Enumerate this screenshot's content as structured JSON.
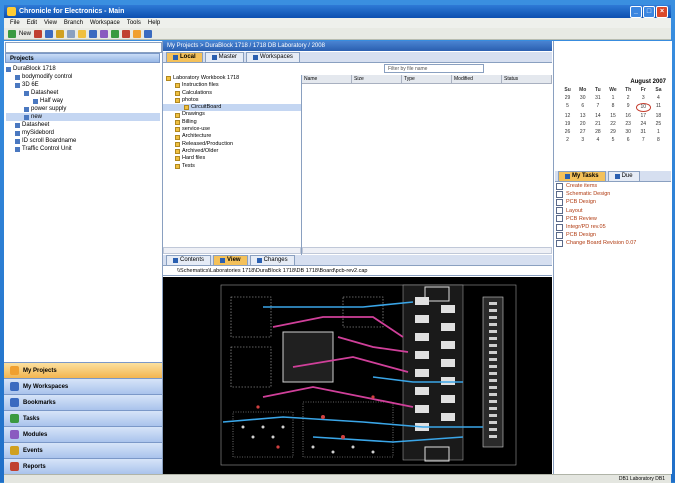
{
  "window": {
    "title": "Chronicle for Electronics - Main"
  },
  "menu": [
    "File",
    "Edit",
    "View",
    "Branch",
    "Workspace",
    "Tools",
    "Help"
  ],
  "toolbar": {
    "new_label": "New"
  },
  "left": {
    "header": "Projects",
    "tree": [
      {
        "label": "DuraBlock 1718",
        "indent": 0
      },
      {
        "label": "bodymodify control",
        "indent": 1
      },
      {
        "label": "3D 6E",
        "indent": 1
      },
      {
        "label": "Datasheet",
        "indent": 2
      },
      {
        "label": "Half way",
        "indent": 3
      },
      {
        "label": "power supply",
        "indent": 2
      },
      {
        "label": "new",
        "indent": 2,
        "selected": true
      },
      {
        "label": "Datasheet",
        "indent": 1
      },
      {
        "label": "mySidebord",
        "indent": 1
      },
      {
        "label": "ID scroll Boardname",
        "indent": 1
      },
      {
        "label": "Traffic Control Unit",
        "indent": 1
      }
    ],
    "nav": [
      {
        "label": "My Projects",
        "color": "#f0a030",
        "active": true
      },
      {
        "label": "My Workspaces",
        "color": "#3a6ac0"
      },
      {
        "label": "Bookmarks",
        "color": "#3a6ac0"
      },
      {
        "label": "Tasks",
        "color": "#3a9a40"
      },
      {
        "label": "Modules",
        "color": "#8a5ac0"
      },
      {
        "label": "Events",
        "color": "#d0a020"
      },
      {
        "label": "Reports",
        "color": "#c04030"
      }
    ]
  },
  "center": {
    "header": "My Projects > DuraBlock 1718 / 1718 DB Laboratory / 2008",
    "tabs": [
      "Local",
      "Master",
      "Workspaces"
    ],
    "filter_label": "Filter by file name",
    "list_columns": [
      "Name",
      "Size",
      "Type",
      "Modified",
      "Status"
    ],
    "file_tree": [
      {
        "label": "Laboratory Workbook 1718",
        "indent": 0
      },
      {
        "label": "Instruction files",
        "indent": 1
      },
      {
        "label": "Calculations",
        "indent": 1
      },
      {
        "label": "photos",
        "indent": 1
      },
      {
        "label": "CircuitBoard",
        "indent": 2,
        "selected": true
      },
      {
        "label": "Drawings",
        "indent": 1
      },
      {
        "label": "Billing",
        "indent": 1
      },
      {
        "label": "service-use",
        "indent": 1
      },
      {
        "label": "Architecture",
        "indent": 1
      },
      {
        "label": "Released/Production",
        "indent": 1
      },
      {
        "label": "Archived/Older",
        "indent": 1
      },
      {
        "label": "Hard files",
        "indent": 1
      },
      {
        "label": "Tests",
        "indent": 1
      }
    ],
    "view_tabs": [
      "Contents",
      "View",
      "Changes"
    ],
    "view_path": "\\\\Schematics\\Laboratories 1718\\DuraBlock 1718\\DB 1718\\Board\\pcb-rev2.cap"
  },
  "right": {
    "calendar": {
      "month": "August 2007",
      "days_header": [
        "Su",
        "Mo",
        "Tu",
        "We",
        "Th",
        "Fr",
        "Sa"
      ],
      "weeks": [
        [
          "29",
          "30",
          "31",
          "1",
          "2",
          "3",
          "4"
        ],
        [
          "5",
          "6",
          "7",
          "8",
          "9",
          "10",
          "11"
        ],
        [
          "12",
          "13",
          "14",
          "15",
          "16",
          "17",
          "18"
        ],
        [
          "19",
          "20",
          "21",
          "22",
          "23",
          "24",
          "25"
        ],
        [
          "26",
          "27",
          "28",
          "29",
          "30",
          "31",
          "1"
        ],
        [
          "2",
          "3",
          "4",
          "5",
          "6",
          "7",
          "8"
        ]
      ],
      "today": "10"
    },
    "task_tabs": [
      "My Tasks",
      "Due"
    ],
    "tasks": [
      "Create items",
      "Schematic Design",
      "PCB Design",
      "Layout",
      "PCB Review",
      "Integr/PD rev.05",
      "PCB Design",
      "Change Board Revision 0.07"
    ]
  },
  "status": {
    "text": "DB1 Laboratory DB1"
  }
}
